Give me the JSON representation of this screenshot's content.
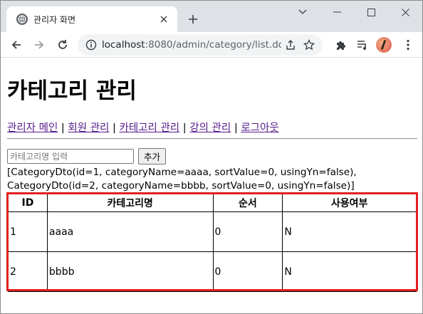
{
  "browser": {
    "tab_title": "관리자 화면",
    "url_host": "localhost",
    "url_rest": ":8080/admin/category/list.do"
  },
  "page": {
    "title": "카테고리 관리",
    "nav": [
      {
        "label": "관리자 메인"
      },
      {
        "label": "회원 관리"
      },
      {
        "label": "카테고리 관리"
      },
      {
        "label": "강의 관리"
      },
      {
        "label": "로그아웃"
      }
    ],
    "nav_separator": "|",
    "form": {
      "input_placeholder": "카테고리명 입력",
      "add_button": "추가"
    },
    "dto_text": "[CategoryDto(id=1, categoryName=aaaa, sortValue=0, usingYn=false),\nCategoryDto(id=2, categoryName=bbbb, sortValue=0, usingYn=false)]",
    "table": {
      "headers": [
        "ID",
        "카테고리명",
        "순서",
        "사용여부"
      ],
      "rows": [
        [
          "1",
          "aaaa",
          "0",
          "N"
        ],
        [
          "2",
          "bbbb",
          "0",
          "N"
        ]
      ]
    }
  },
  "colors": {
    "highlight": "#e0201f",
    "visited_link": "#551a8b"
  }
}
